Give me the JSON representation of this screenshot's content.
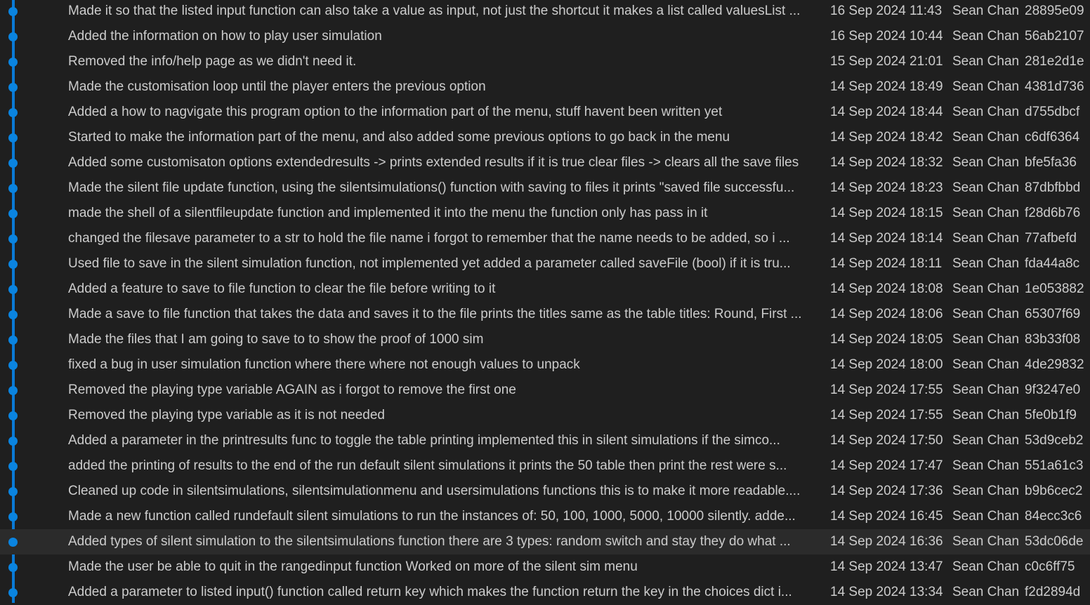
{
  "colors": {
    "background": "#1f1f1f",
    "graph": "#0a84e0",
    "text": "#cccccc",
    "selected_row": "#2b2b2b"
  },
  "selected_index": 21,
  "commits": [
    {
      "message": "Made it so that the listed input function can also take a value as input, not just the shortcut it makes a list called valuesList ...",
      "date": "16 Sep 2024 11:43",
      "author": "Sean Chan",
      "hash": "28895e09"
    },
    {
      "message": "Added the information on how to play user simulation",
      "date": "16 Sep 2024 10:44",
      "author": "Sean Chan",
      "hash": "56ab2107"
    },
    {
      "message": "Removed the info/help page as we didn't need it.",
      "date": "15 Sep 2024 21:01",
      "author": "Sean Chan",
      "hash": "281e2d1e"
    },
    {
      "message": "Made the customisation loop until the player enters the previous option",
      "date": "14 Sep 2024 18:49",
      "author": "Sean Chan",
      "hash": "4381d736"
    },
    {
      "message": "Added a how to nagvigate this program option to the information part of the menu, stuff havent been written yet",
      "date": "14 Sep 2024 18:44",
      "author": "Sean Chan",
      "hash": "d755dbcf"
    },
    {
      "message": "Started to make the information part of the menu, and also added some previous options to go back in the menu",
      "date": "14 Sep 2024 18:42",
      "author": "Sean Chan",
      "hash": "c6df6364"
    },
    {
      "message": "Added some customisaton options extendedresults -> prints extended results if it is true clear files -> clears all the save files",
      "date": "14 Sep 2024 18:32",
      "author": "Sean Chan",
      "hash": "bfe5fa36"
    },
    {
      "message": "Made the silent file update function, using the silentsimulations() function with saving to files it prints \"saved file successfu...",
      "date": "14 Sep 2024 18:23",
      "author": "Sean Chan",
      "hash": "87dbfbbd"
    },
    {
      "message": "made the shell of a silentfileupdate function and implemented it into the menu the function only has pass in it",
      "date": "14 Sep 2024 18:15",
      "author": "Sean Chan",
      "hash": "f28d6b76"
    },
    {
      "message": "changed the filesave parameter to a str to hold the file name i forgot to remember that the name needs to be added, so i ...",
      "date": "14 Sep 2024 18:14",
      "author": "Sean Chan",
      "hash": "77afbefd"
    },
    {
      "message": "Used file to save in the silent simulation function, not implemented yet added a parameter called saveFile (bool) if it is tru...",
      "date": "14 Sep 2024 18:11",
      "author": "Sean Chan",
      "hash": "fda44a8c"
    },
    {
      "message": "Added a feature to save to file function to clear the file before writing to it",
      "date": "14 Sep 2024 18:08",
      "author": "Sean Chan",
      "hash": "1e053882"
    },
    {
      "message": "Made a save to file function that takes the data and saves it to the file prints the titles same as the table titles: Round, First ...",
      "date": "14 Sep 2024 18:06",
      "author": "Sean Chan",
      "hash": "65307f69"
    },
    {
      "message": "Made the files that I am going to save to to show the proof of 1000 sim",
      "date": "14 Sep 2024 18:05",
      "author": "Sean Chan",
      "hash": "83b33f08"
    },
    {
      "message": "fixed a bug in user simulation function where there where not enough values to unpack",
      "date": "14 Sep 2024 18:00",
      "author": "Sean Chan",
      "hash": "4de29832"
    },
    {
      "message": "Removed the playing type variable AGAIN as i forgot to remove the first one",
      "date": "14 Sep 2024 17:55",
      "author": "Sean Chan",
      "hash": "9f3247e0"
    },
    {
      "message": "Removed the playing type variable as it is not needed",
      "date": "14 Sep 2024 17:55",
      "author": "Sean Chan",
      "hash": "5fe0b1f9"
    },
    {
      "message": "Added a parameter in the printresults func to toggle the table printing implemented this in silent simulations if the simco...",
      "date": "14 Sep 2024 17:50",
      "author": "Sean Chan",
      "hash": "53d9ceb2"
    },
    {
      "message": "added the printing of results to the end of the run default silent simulations it prints the 50 table then print the rest were s...",
      "date": "14 Sep 2024 17:47",
      "author": "Sean Chan",
      "hash": "551a61c3"
    },
    {
      "message": "Cleaned up code in silentsimulations, silentsimulationmenu and usersimulations functions this is to make it more readable....",
      "date": "14 Sep 2024 17:36",
      "author": "Sean Chan",
      "hash": "b9b6cec2"
    },
    {
      "message": "Made a new function called rundefault silent simulations to run the instances of: 50, 100, 1000, 5000, 10000 silently. adde...",
      "date": "14 Sep 2024 16:45",
      "author": "Sean Chan",
      "hash": "84ecc3c6"
    },
    {
      "message": "Added types of silent simulation to the silentsimulations function there are 3 types: random switch and stay they do what ...",
      "date": "14 Sep 2024 16:36",
      "author": "Sean Chan",
      "hash": "53dc06de"
    },
    {
      "message": "Made the user be able to quit in the rangedinput function Worked on more of the silent sim menu",
      "date": "14 Sep 2024 13:47",
      "author": "Sean Chan",
      "hash": "c0c6ff75"
    },
    {
      "message": "Added a parameter to listed input() function called return key which makes the function return the key in the choices dict i...",
      "date": "14 Sep 2024 13:34",
      "author": "Sean Chan",
      "hash": "f2d2894d"
    }
  ]
}
